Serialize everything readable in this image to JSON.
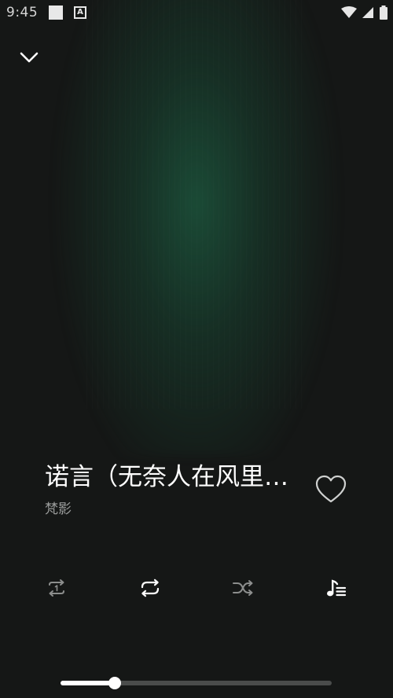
{
  "status_bar": {
    "time": "9:45",
    "notification_letter": "A"
  },
  "player": {
    "song_title": "诺言（无奈人在风里…",
    "artist": "梵影",
    "progress": 0.2
  },
  "colors": {
    "background": "#151716",
    "artwork_glow": "#1c543c",
    "title": "#ffffff",
    "artist": "#9a9c9b",
    "inactive_control": "#8c8e8d",
    "active_control": "#ffffff",
    "progress_track": "#4a4c4b"
  },
  "icons": {
    "collapse": "chevron-down-icon",
    "like": "heart-outline-icon",
    "repeat_one": "repeat-one-icon",
    "repeat": "repeat-icon",
    "shuffle": "shuffle-icon",
    "playlist": "playlist-icon"
  }
}
